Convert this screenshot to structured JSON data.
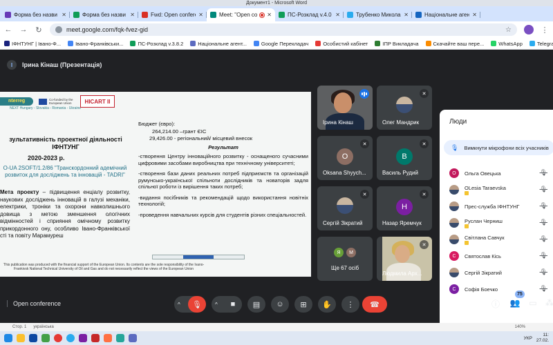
{
  "word_title": "Документ1 - Microsoft Word",
  "tabs": [
    {
      "label": "Форма без назви - G",
      "color": "#673ab7",
      "active": false
    },
    {
      "label": "Форма без назви (Від",
      "color": "#0f9d58",
      "active": false
    },
    {
      "label": "Fwd: Open conference",
      "color": "#d93025",
      "active": false
    },
    {
      "label": "Meet: \"Open conf",
      "color": "#00897b",
      "active": true
    },
    {
      "label": "ПС-Розклад v.4.0",
      "color": "#0f9d58",
      "active": false
    },
    {
      "label": "Трубенко Миколайов",
      "color": "#2aabee",
      "active": false
    },
    {
      "label": "Національне агентст",
      "color": "#1565c0",
      "active": false
    }
  ],
  "url": "meet.google.com/fqk-fvez-gid",
  "bookmarks": [
    {
      "label": "ІФНТУНГ | Івано-Ф...",
      "color": "#1a237e"
    },
    {
      "label": "Івано-Франківськи...",
      "color": "#4285f4"
    },
    {
      "label": "ПС-Розклад v.3.8.2",
      "color": "#0f9d58"
    },
    {
      "label": "Національне агент...",
      "color": "#5c6bc0"
    },
    {
      "label": "Google Перекладач",
      "color": "#4285f4"
    },
    {
      "label": "Особистий кабінет",
      "color": "#e53935"
    },
    {
      "label": "ІПР Викладача",
      "color": "#2e7d32"
    },
    {
      "label": "Скачайте ваш пере...",
      "color": "#fb8c00"
    },
    {
      "label": "WhatsApp",
      "color": "#25d366"
    },
    {
      "label": "Telegram",
      "color": "#2aabee"
    }
  ],
  "presenter_label": "Ірина Кінаш (Презентація)",
  "slide": {
    "logo_text": "nterreg",
    "logo_sub": "NEXT Hungary - Slovakia - Romania - Ukraine",
    "eu_text": "Co-funded by the European Union",
    "hicart": "HICART II",
    "title": "зультативність проектної діяльності ІФНТУНГ",
    "years": "2020-2023 р.",
    "project": "О-UA 2SOFT/1.2/86 \"Транскордонний адемічний розвиток для досліджень та інновацій - TADRI\"",
    "body_lead": "Мета проекту",
    "body": " – підвищення енціалу розвитку, наукових досліджень інновацій в галузі механіки, електрики, троніки та охорони навколишнього довища з метою зменшення ологічних відмінностей і сприяння омічному розвитку прикордонного ону, особливо Івано-Франківської сті та повіту Марамуреш",
    "budget_title": "Бюджет (євро):",
    "budget_1": "264,214.00 –грант ЄІС",
    "budget_2": "29,426.00 - регіональний/ місцевий внесок",
    "result_title": "Результат",
    "results": [
      "-створення Центру інноваційного розвитку - оснащеного сучасними цифровими засобами виробництва при технічному університеті;",
      "-створення бази даних реальних потреб підприємств та організацій румунсько-української спільноти дослідників та новаторів задля спільної роботи із вирішення таких потреб;",
      "-видання посібників та рекомендацій щодо використання новітніх технологій;",
      "-проведення навчальних курсів для студентів різних спеціальностей."
    ],
    "footer": "This publication was produced with the financial support of the European Union. Its contents are the sole responsibility of the Ivano-Frankivsk National Technical University of Oil and Gas and do not necessarily reflect the views of the European Union"
  },
  "tiles": [
    {
      "name": "Ірина Кінаш",
      "kind": "camera1"
    },
    {
      "name": "Олег Мандрик",
      "kind": "photo"
    },
    {
      "name": "Oksana Shyych...",
      "kind": "initial",
      "initial": "O",
      "color": "#8d6e63"
    },
    {
      "name": "Василь Рудий",
      "kind": "initial",
      "initial": "В",
      "color": "#00796b"
    },
    {
      "name": "Сергій Зікратий",
      "kind": "photo"
    },
    {
      "name": "Назар Яремчук",
      "kind": "initial",
      "initial": "Н",
      "color": "#7b1fa2"
    },
    {
      "name": "Ще 67 осіб",
      "kind": "more"
    },
    {
      "name": "Людмила Арх...",
      "kind": "camera2"
    }
  ],
  "more_avatars": [
    {
      "initial": "Я",
      "color": "#689f38"
    },
    {
      "initial": "М",
      "color": "#8d6e63"
    }
  ],
  "meeting_name": "Open conference",
  "participant_count": "75",
  "people": {
    "title": "Люди",
    "mute_all": "Вимкнути мікрофони всіх учасників",
    "list": [
      {
        "name": "Ольга Овецька",
        "initial": "О",
        "color": "#c2185b",
        "tag": false,
        "photo": false
      },
      {
        "name": "OLesia Taraevska",
        "initial": "",
        "color": "#795548",
        "tag": true,
        "photo": true
      },
      {
        "name": "Прес-служба ІФНТУНГ",
        "initial": "",
        "color": "#1a237e",
        "tag": false,
        "photo": true
      },
      {
        "name": "Руслан Черниш",
        "initial": "",
        "color": "#5d4037",
        "tag": true,
        "photo": true
      },
      {
        "name": "Світлана Савчук",
        "initial": "",
        "color": "#6d4c41",
        "tag": true,
        "photo": true
      },
      {
        "name": "Святослав Кісь",
        "initial": "С",
        "color": "#d81b60",
        "tag": false,
        "photo": false
      },
      {
        "name": "Сергій Зікратий",
        "initial": "",
        "color": "#455a64",
        "tag": false,
        "photo": true
      },
      {
        "name": "Софія Боечко",
        "initial": "С",
        "color": "#7b1fa2",
        "tag": false,
        "photo": false
      }
    ]
  },
  "word_status": {
    "page": "Стор. 1",
    "lang": "українська",
    "zoom": "140%"
  },
  "taskbar": {
    "lang": "УКР",
    "time": "11:",
    "date": "27.02."
  }
}
